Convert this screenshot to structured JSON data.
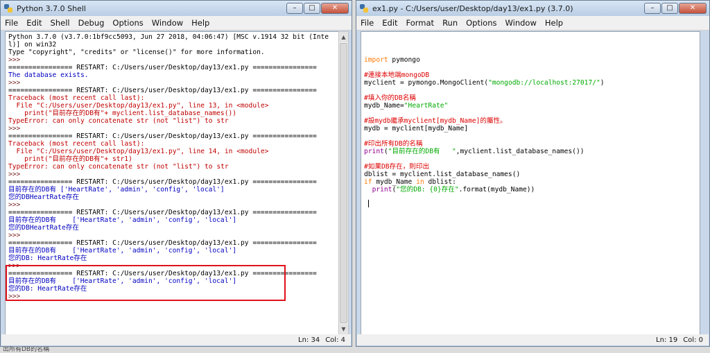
{
  "shell": {
    "title": "Python 3.7.0 Shell",
    "menu": [
      "File",
      "Edit",
      "Shell",
      "Debug",
      "Options",
      "Window",
      "Help"
    ],
    "lines": [
      {
        "text": "Python 3.7.0 (v3.7.0:1bf9cc5093, Jun 27 2018, 04:06:47) [MSC v.1914 32 bit (Inte",
        "style": "black"
      },
      {
        "text": "l)] on win32",
        "style": "black"
      },
      {
        "text": "Type \"copyright\", \"credits\" or \"license()\" for more information.",
        "style": "black"
      },
      {
        "text": ">>> ",
        "style": "prompt"
      },
      {
        "text": "================ RESTART: C:/Users/user/Desktop/day13/ex1.py ================",
        "style": "black"
      },
      {
        "text": "The database exists.",
        "style": "out"
      },
      {
        "text": ">>> ",
        "style": "prompt"
      },
      {
        "text": "================ RESTART: C:/Users/user/Desktop/day13/ex1.py ================",
        "style": "black"
      },
      {
        "text": "Traceback (most recent call last):",
        "style": "err"
      },
      {
        "text": "  File \"C:/Users/user/Desktop/day13/ex1.py\", line 13, in <module>",
        "style": "err"
      },
      {
        "text": "    print(\"目前存在的DB有\"+ myclient.list_database_names())",
        "style": "err"
      },
      {
        "text": "TypeError: can only concatenate str (not \"list\") to str",
        "style": "err"
      },
      {
        "text": ">>> ",
        "style": "prompt"
      },
      {
        "text": "================ RESTART: C:/Users/user/Desktop/day13/ex1.py ================",
        "style": "black"
      },
      {
        "text": "Traceback (most recent call last):",
        "style": "err"
      },
      {
        "text": "  File \"C:/Users/user/Desktop/day13/ex1.py\", line 14, in <module>",
        "style": "err"
      },
      {
        "text": "    print(\"目前存在的DB有\"+ str1)",
        "style": "err"
      },
      {
        "text": "TypeError: can only concatenate str (not \"list\") to str",
        "style": "err"
      },
      {
        "text": ">>> ",
        "style": "prompt"
      },
      {
        "text": "================ RESTART: C:/Users/user/Desktop/day13/ex1.py ================",
        "style": "black"
      },
      {
        "text": "目前存在的DB有 ['HeartRate', 'admin', 'config', 'local']",
        "style": "out"
      },
      {
        "text": "您的DBHeartRate存在",
        "style": "out"
      },
      {
        "text": ">>> ",
        "style": "prompt"
      },
      {
        "text": "================ RESTART: C:/Users/user/Desktop/day13/ex1.py ================",
        "style": "black"
      },
      {
        "text": "目前存在的DB有    ['HeartRate', 'admin', 'config', 'local']",
        "style": "out"
      },
      {
        "text": "您的DBHeartRate存在",
        "style": "out"
      },
      {
        "text": ">>> ",
        "style": "prompt"
      },
      {
        "text": "================ RESTART: C:/Users/user/Desktop/day13/ex1.py ================",
        "style": "black"
      },
      {
        "text": "目前存在的DB有    ['HeartRate', 'admin', 'config', 'local']",
        "style": "out"
      },
      {
        "text": "您的DB: HeartRate存在",
        "style": "out"
      },
      {
        "text": ">>> ",
        "style": "prompt"
      },
      {
        "text": "================ RESTART: C:/Users/user/Desktop/day13/ex1.py ================",
        "style": "black"
      },
      {
        "text": "目前存在的DB有    ['HeartRate', 'admin', 'config', 'local']",
        "style": "out"
      },
      {
        "text": "您的DB: HeartRate存在",
        "style": "out"
      },
      {
        "text": ">>> ",
        "style": "prompt"
      }
    ],
    "status": {
      "ln": "Ln: 34",
      "col": "Col: 4"
    }
  },
  "editor": {
    "title": "ex1.py - C:/Users/user/Desktop/day13/ex1.py (3.7.0)",
    "menu": [
      "File",
      "Edit",
      "Format",
      "Run",
      "Options",
      "Window",
      "Help"
    ],
    "lines": [
      [
        {
          "t": "import",
          "s": "kw"
        },
        {
          "t": " pymongo",
          "s": "black"
        }
      ],
      [],
      [
        {
          "t": "#連接本地端mongoDB",
          "s": "comment"
        }
      ],
      [
        {
          "t": "myclient = pymongo.MongoClient(",
          "s": "black"
        },
        {
          "t": "\"mongodb://localhost:27017/\"",
          "s": "str"
        },
        {
          "t": ")",
          "s": "black"
        }
      ],
      [],
      [
        {
          "t": "#填入你的DB名稱",
          "s": "comment"
        }
      ],
      [
        {
          "t": "mydb_Name=",
          "s": "black"
        },
        {
          "t": "\"HeartRate\"",
          "s": "str"
        }
      ],
      [],
      [
        {
          "t": "#設mydb繼承myclient[mydb_Name]的屬性。",
          "s": "comment"
        }
      ],
      [
        {
          "t": "mydb = myclient[mydb_Name]",
          "s": "black"
        }
      ],
      [],
      [
        {
          "t": "#印出所有DB的名稱",
          "s": "comment"
        }
      ],
      [
        {
          "t": "print",
          "s": "builtin"
        },
        {
          "t": "(",
          "s": "black"
        },
        {
          "t": "\"目前存在的DB有   \"",
          "s": "str"
        },
        {
          "t": ",myclient.list_database_names())",
          "s": "black"
        }
      ],
      [],
      [
        {
          "t": "#如果DB存在，則印出",
          "s": "comment"
        }
      ],
      [
        {
          "t": "dblist = myclient.list_database_names()",
          "s": "black"
        }
      ],
      [
        {
          "t": "if",
          "s": "kw"
        },
        {
          "t": " mydb_Name ",
          "s": "black"
        },
        {
          "t": "in",
          "s": "kw"
        },
        {
          "t": " dblist:",
          "s": "black"
        }
      ],
      [
        {
          "t": "  ",
          "s": "black"
        },
        {
          "t": "print",
          "s": "builtin"
        },
        {
          "t": "(",
          "s": "black"
        },
        {
          "t": "\"您的DB: {0}存在\"",
          "s": "str"
        },
        {
          "t": ".format(mydb_Name))",
          "s": "black"
        }
      ]
    ],
    "status": {
      "ln": "Ln: 19",
      "col": "Col: 0"
    }
  },
  "bottom_strip_text": "出所有DB的名稱",
  "colors": {
    "highlight_border": "#e0111b",
    "output": "#0000c0",
    "error": "#c00000"
  }
}
